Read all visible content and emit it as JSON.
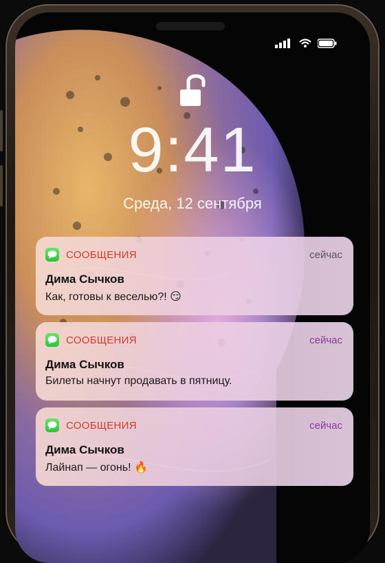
{
  "status_bar": {
    "icons": [
      "signal-icon",
      "wifi-icon",
      "battery-icon"
    ]
  },
  "lock_screen": {
    "lock_state": "unlocked",
    "time": "9:41",
    "date": "Среда, 12 сентября"
  },
  "notifications": [
    {
      "app": "СООБЩЕНИЯ",
      "time": "сейчас",
      "sender": "Дима Сычков",
      "message": "Как, готовы к веселью?! 😏"
    },
    {
      "app": "СООБЩЕНИЯ",
      "time": "сейчас",
      "sender": "Дима Сычков",
      "message": "Билеты начнут продавать в пятницу."
    },
    {
      "app": "СООБЩЕНИЯ",
      "time": "сейчас",
      "sender": "Дима Сычков",
      "message": "Лайнап — огонь! 🔥"
    }
  ],
  "colors": {
    "app_name": "#d23a2e",
    "time_accent_1": "#555555",
    "time_accent_2": "#8a3a9a",
    "messages_icon": "#2fc53d"
  }
}
